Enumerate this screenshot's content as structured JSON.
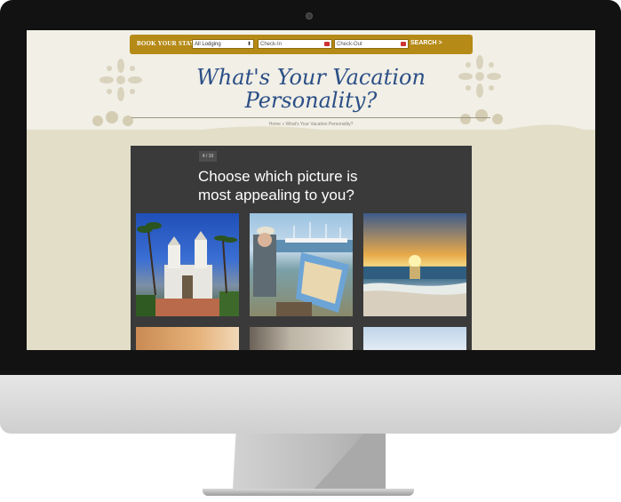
{
  "booking": {
    "label": "BOOK YOUR STAY",
    "lodging_value": "All Lodging",
    "checkin_placeholder": "Check-In",
    "checkout_placeholder": "Check-Out",
    "search_label": "SEARCH >"
  },
  "page": {
    "title_line1": "What's Your Vacation",
    "title_line2": "Personality?",
    "breadcrumb": "Home » What's Your Vacation Personality?"
  },
  "quiz": {
    "counter": "4 / 10",
    "question_line1": "Choose which picture is",
    "question_line2": "most appealing to you?"
  },
  "colors": {
    "booking_bar": "#b58a16",
    "title": "#2b4f86",
    "panel": "#3a3a3a"
  }
}
